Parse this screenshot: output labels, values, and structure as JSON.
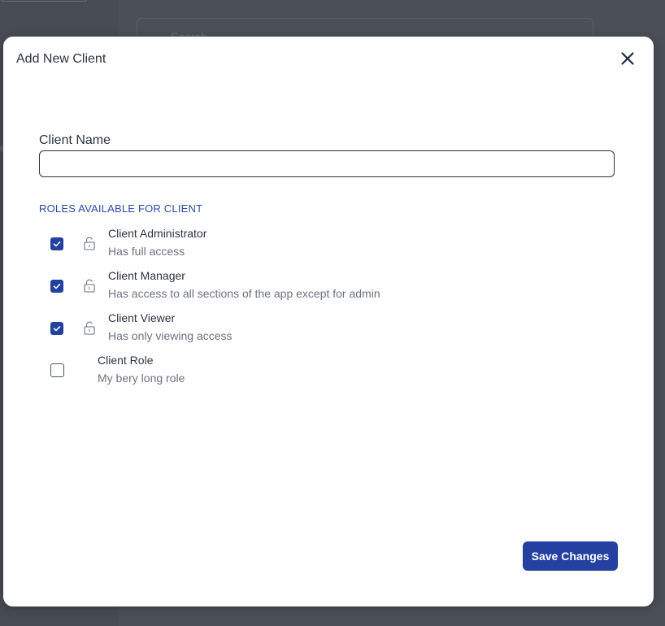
{
  "background": {
    "search_placeholder": "Search"
  },
  "modal": {
    "title": "Add New Client",
    "close_icon": "close-icon"
  },
  "form": {
    "client_name_label": "Client Name",
    "client_name_value": "",
    "client_name_placeholder": ""
  },
  "roles": {
    "heading": "ROLES AVAILABLE FOR CLIENT",
    "items": [
      {
        "name": "Client Administrator",
        "description": "Has full access",
        "checked": true,
        "locked": true
      },
      {
        "name": "Client Manager",
        "description": "Has access to all sections of the app except for admin",
        "checked": true,
        "locked": true
      },
      {
        "name": "Client Viewer",
        "description": "Has only viewing access",
        "checked": true,
        "locked": true
      },
      {
        "name": "Client Role",
        "description": "My bery long role",
        "checked": false,
        "locked": false
      }
    ]
  },
  "footer": {
    "save_label": "Save Changes"
  },
  "colors": {
    "accent": "#2440a0",
    "heading_accent": "#2d4aa6",
    "text": "#2b3441",
    "muted": "#6b7280",
    "overlay": "#474b52"
  }
}
